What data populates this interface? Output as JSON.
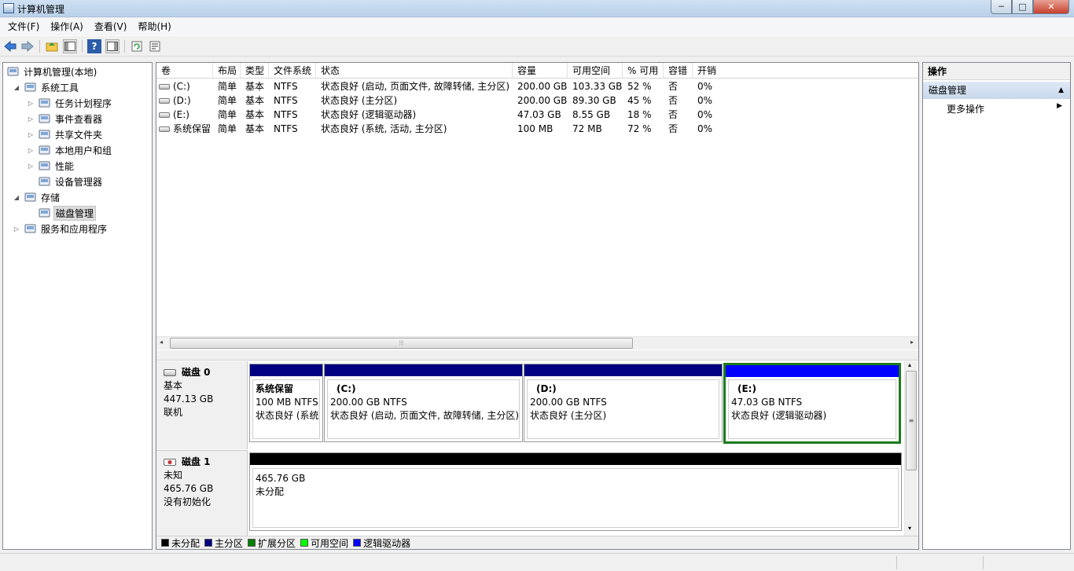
{
  "window": {
    "title": "计算机管理",
    "min_glyph": "─",
    "max_glyph": "□",
    "close_glyph": "✕"
  },
  "menu": [
    "文件(F)",
    "操作(A)",
    "查看(V)",
    "帮助(H)"
  ],
  "toolbar": {
    "icons": [
      "back-arrow-icon",
      "forward-arrow-icon",
      "up-folder-icon",
      "show-hide-tree-icon",
      "help-icon",
      "show-hide-action-pane-icon",
      "refresh-icon",
      "properties-icon"
    ],
    "help_glyph": "?"
  },
  "tree": [
    {
      "label": "计算机管理(本地)",
      "level": 0,
      "expander": "",
      "icon": "computer-management-icon"
    },
    {
      "label": "系统工具",
      "level": 1,
      "expander": "◢",
      "icon": "system-tools-icon"
    },
    {
      "label": "任务计划程序",
      "level": 2,
      "expander": "▷",
      "icon": "task-scheduler-icon"
    },
    {
      "label": "事件查看器",
      "level": 2,
      "expander": "▷",
      "icon": "event-viewer-icon"
    },
    {
      "label": "共享文件夹",
      "level": 2,
      "expander": "▷",
      "icon": "shared-folders-icon"
    },
    {
      "label": "本地用户和组",
      "level": 2,
      "expander": "▷",
      "icon": "local-users-groups-icon"
    },
    {
      "label": "性能",
      "level": 2,
      "expander": "▷",
      "icon": "performance-icon"
    },
    {
      "label": "设备管理器",
      "level": 2,
      "expander": "",
      "icon": "device-manager-icon"
    },
    {
      "label": "存储",
      "level": 1,
      "expander": "◢",
      "icon": "storage-icon"
    },
    {
      "label": "磁盘管理",
      "level": 2,
      "expander": "",
      "icon": "disk-management-icon",
      "selected": true
    },
    {
      "label": "服务和应用程序",
      "level": 1,
      "expander": "▷",
      "icon": "services-applications-icon"
    }
  ],
  "volume_table": {
    "columns": [
      "卷",
      "布局",
      "类型",
      "文件系统",
      "状态",
      "容量",
      "可用空间",
      "% 可用",
      "容错",
      "开销"
    ],
    "rows": [
      [
        "(C:)",
        "简单",
        "基本",
        "NTFS",
        "状态良好 (启动, 页面文件, 故障转储, 主分区)",
        "200.00 GB",
        "103.33 GB",
        "52 %",
        "否",
        "0%"
      ],
      [
        "(D:)",
        "简单",
        "基本",
        "NTFS",
        "状态良好 (主分区)",
        "200.00 GB",
        "89.30 GB",
        "45 %",
        "否",
        "0%"
      ],
      [
        "(E:)",
        "简单",
        "基本",
        "NTFS",
        "状态良好 (逻辑驱动器)",
        "47.03 GB",
        "8.55 GB",
        "18 %",
        "否",
        "0%"
      ],
      [
        "系统保留",
        "简单",
        "基本",
        "NTFS",
        "状态良好 (系统, 活动, 主分区)",
        "100 MB",
        "72 MB",
        "72 %",
        "否",
        "0%"
      ]
    ]
  },
  "scroll": {
    "left": "◂",
    "right": "▸",
    "up": "▴",
    "down": "▾",
    "grip_h": "⦙⦙⦙",
    "grip_v": "≡"
  },
  "disks": [
    {
      "name": "磁盘 0",
      "type": "基本",
      "size": "447.13 GB",
      "state": "联机",
      "partitions": [
        {
          "name": "系统保留",
          "size": "100 MB NTFS",
          "status": "状态良好 (系统",
          "kind": "primary"
        },
        {
          "name": "(C:)",
          "size": "200.00 GB NTFS",
          "status": "状态良好 (启动, 页面文件, 故障转储, 主分区)",
          "kind": "primary"
        },
        {
          "name": "(D:)",
          "size": "200.00 GB NTFS",
          "status": "状态良好 (主分区)",
          "kind": "primary"
        },
        {
          "name": "(E:)",
          "size": "47.03 GB NTFS",
          "status": "状态良好 (逻辑驱动器)",
          "kind": "logical",
          "selected": true
        }
      ]
    },
    {
      "name": "磁盘 1",
      "type": "未知",
      "size": "465.76 GB",
      "state": "没有初始化",
      "partitions": [
        {
          "name": "",
          "size": "465.76 GB",
          "status": "未分配",
          "kind": "unallocated"
        }
      ]
    }
  ],
  "legend": [
    {
      "label": "未分配",
      "color": "#000000"
    },
    {
      "label": "主分区",
      "color": "#000080"
    },
    {
      "label": "扩展分区",
      "color": "#008000"
    },
    {
      "label": "可用空间",
      "color": "#00ff00"
    },
    {
      "label": "逻辑驱动器",
      "color": "#0000ff"
    }
  ],
  "actions": {
    "title": "操作",
    "section": "磁盘管理",
    "more": "更多操作",
    "collapse_glyph": "▲",
    "more_glyph": "▶"
  },
  "colors": {
    "primary": "#000080",
    "logical": "#0000ff",
    "unallocated": "#000000",
    "selection_border": "#1b7a1b"
  }
}
